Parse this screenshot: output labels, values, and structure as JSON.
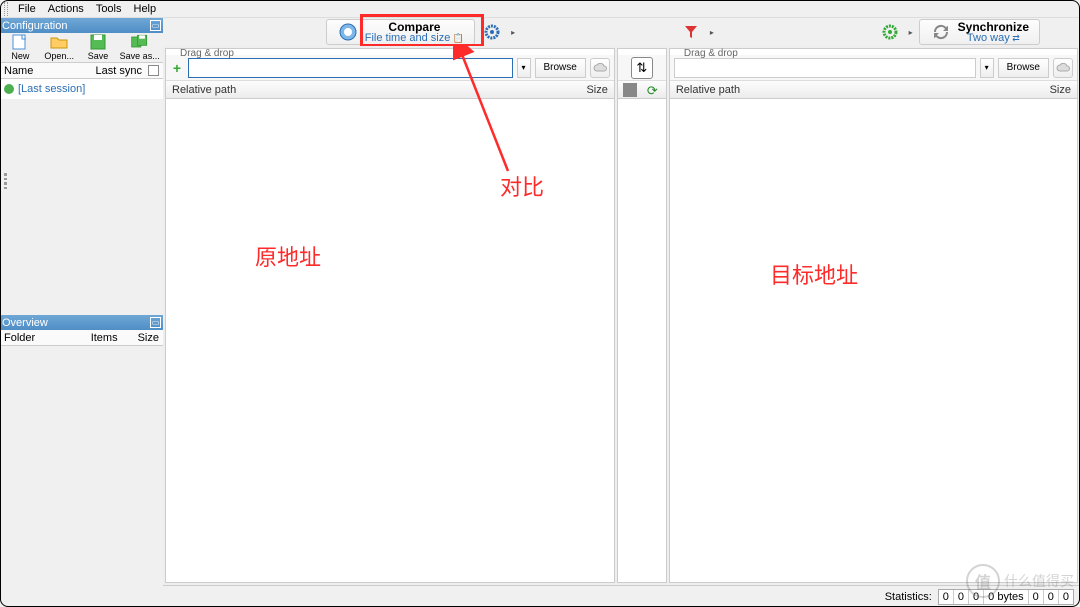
{
  "menu": {
    "file": "File",
    "actions": "Actions",
    "tools": "Tools",
    "help": "Help"
  },
  "sidebar": {
    "config_title": "Configuration",
    "buttons": {
      "new": "New",
      "open": "Open...",
      "save": "Save",
      "saveas": "Save as..."
    },
    "cols": {
      "name": "Name",
      "lastsync": "Last sync"
    },
    "session": "[Last session]",
    "overview_title": "Overview",
    "ov_cols": {
      "folder": "Folder",
      "items": "Items",
      "size": "Size"
    }
  },
  "toolbar": {
    "compare": {
      "title": "Compare",
      "sub": "File time and size"
    },
    "sync": {
      "title": "Synchronize",
      "sub": "Two way"
    }
  },
  "pane": {
    "dragdrop": "Drag & drop",
    "relpath": "Relative path",
    "size": "Size",
    "browse": "Browse"
  },
  "status": {
    "label": "Statistics:",
    "c1": "0",
    "c2": "0",
    "c3": "0",
    "bytes": "0 bytes",
    "c4": "0",
    "c5": "0",
    "c6": "0"
  },
  "annotations": {
    "compare": "对比",
    "source": "原地址",
    "target": "目标地址"
  },
  "watermark": "什么值得买"
}
